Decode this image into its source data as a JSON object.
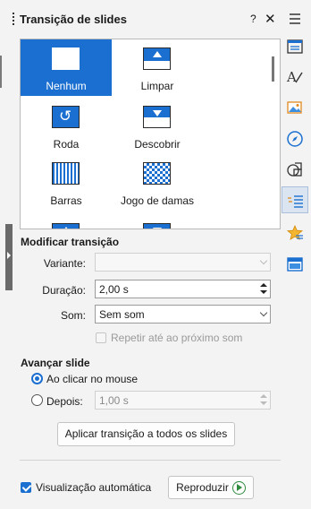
{
  "panel": {
    "title": "Transição de slides",
    "help_label": "?",
    "close_label": "✕"
  },
  "gallery": {
    "items": [
      {
        "label": "Nenhum",
        "icon": "none-transition-icon",
        "selected": true
      },
      {
        "label": "Limpar",
        "icon": "wipe-transition-icon",
        "selected": false
      },
      {
        "label": "Roda",
        "icon": "wheel-transition-icon",
        "selected": false
      },
      {
        "label": "Descobrir",
        "icon": "uncover-transition-icon",
        "selected": false
      },
      {
        "label": "Barras",
        "icon": "bars-transition-icon",
        "selected": false
      },
      {
        "label": "Jogo de damas",
        "icon": "checkerboard-transition-icon",
        "selected": false
      }
    ]
  },
  "modify": {
    "title": "Modificar transição",
    "variant_label": "Variante:",
    "variant_value": "",
    "duration_label": "Duração:",
    "duration_value": "2,00 s",
    "sound_label": "Som:",
    "sound_value": "Sem som",
    "repeat_label": "Repetir até ao próximo som"
  },
  "advance": {
    "title": "Avançar slide",
    "on_click_label": "Ao clicar no mouse",
    "on_click_selected": true,
    "after_label": "Depois:",
    "after_value": "1,00 s"
  },
  "apply_all_label": "Aplicar transição a todos os slides",
  "autopreview_label": "Visualização automática",
  "autopreview_checked": true,
  "play_label": "Reproduzir",
  "colors": {
    "accent": "#1b6fd0",
    "play": "#2e8b3e"
  },
  "sidebar": {
    "items": [
      {
        "icon": "hamburger-menu-icon"
      },
      {
        "icon": "properties-icon"
      },
      {
        "icon": "styles-icon"
      },
      {
        "icon": "gallery-icon"
      },
      {
        "icon": "navigator-icon"
      },
      {
        "icon": "shapes-icon"
      },
      {
        "icon": "slide-transition-icon",
        "active": true
      },
      {
        "icon": "animation-icon"
      },
      {
        "icon": "master-slides-icon"
      }
    ]
  }
}
